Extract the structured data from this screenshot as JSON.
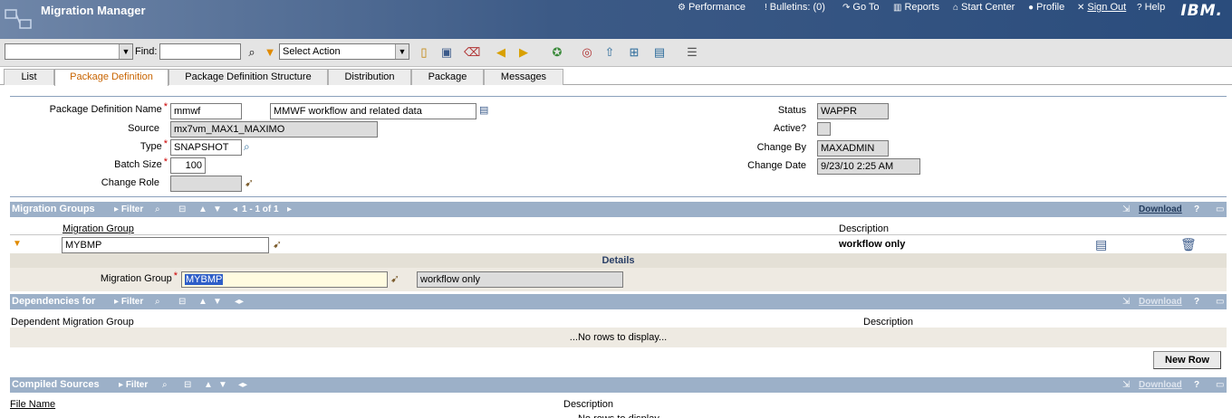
{
  "header": {
    "app_title": "Migration Manager",
    "nav": [
      {
        "label": "Performance",
        "icon": "performance-icon"
      },
      {
        "label": "Bulletins: (0)",
        "icon": "bulletin-icon"
      },
      {
        "label": "Go To",
        "icon": "goto-icon"
      },
      {
        "label": "Reports",
        "icon": "reports-icon"
      },
      {
        "label": "Start Center",
        "icon": "home-icon"
      },
      {
        "label": "Profile",
        "icon": "profile-icon"
      },
      {
        "label": "Sign Out",
        "icon": "signout-icon"
      },
      {
        "label": "Help",
        "icon": "help-icon"
      }
    ],
    "brand": "IBM."
  },
  "toolbar": {
    "query_select_value": "",
    "find_label": "Find:",
    "find_value": "",
    "action_select_value": "Select Action"
  },
  "tabs": [
    {
      "label": "List",
      "active": false
    },
    {
      "label": "Package Definition",
      "active": true
    },
    {
      "label": "Package Definition Structure",
      "active": false
    },
    {
      "label": "Distribution",
      "active": false
    },
    {
      "label": "Package",
      "active": false
    },
    {
      "label": "Messages",
      "active": false
    }
  ],
  "form": {
    "pkg_def_name_label": "Package Definition Name",
    "pkg_def_name_value": "mmwf",
    "pkg_def_desc_value": "MMWF workflow and related data",
    "source_label": "Source",
    "source_value": "mx7vm_MAX1_MAXIMO",
    "type_label": "Type",
    "type_value": "SNAPSHOT",
    "batch_size_label": "Batch Size",
    "batch_size_value": "100",
    "change_role_label": "Change Role",
    "change_role_value": "",
    "status_label": "Status",
    "status_value": "WAPPR",
    "active_label": "Active?",
    "change_by_label": "Change By",
    "change_by_value": "MAXADMIN",
    "change_date_label": "Change Date",
    "change_date_value": "9/23/10 2:25 AM"
  },
  "migration_groups": {
    "title": "Migration Groups",
    "filter_label": "Filter",
    "pager": "1 - 1 of 1",
    "download_label": "Download",
    "col_group": "Migration Group",
    "col_desc": "Description",
    "row_group": "MYBMP",
    "row_desc": "workflow only",
    "details_title": "Details",
    "details_group_label": "Migration Group",
    "details_group_value": "MYBMP",
    "details_desc_value": "workflow only"
  },
  "dependencies": {
    "title": "Dependencies for",
    "filter_label": "Filter",
    "download_label": "Download",
    "col_group": "Dependent Migration Group",
    "col_desc": "Description",
    "empty": "...No rows to display...",
    "new_row_label": "New Row"
  },
  "compiled_sources": {
    "title": "Compiled Sources",
    "filter_label": "Filter",
    "download_label": "Download",
    "col_file": "File Name",
    "col_desc": "Description",
    "empty_partial": "...No rows to display..."
  }
}
